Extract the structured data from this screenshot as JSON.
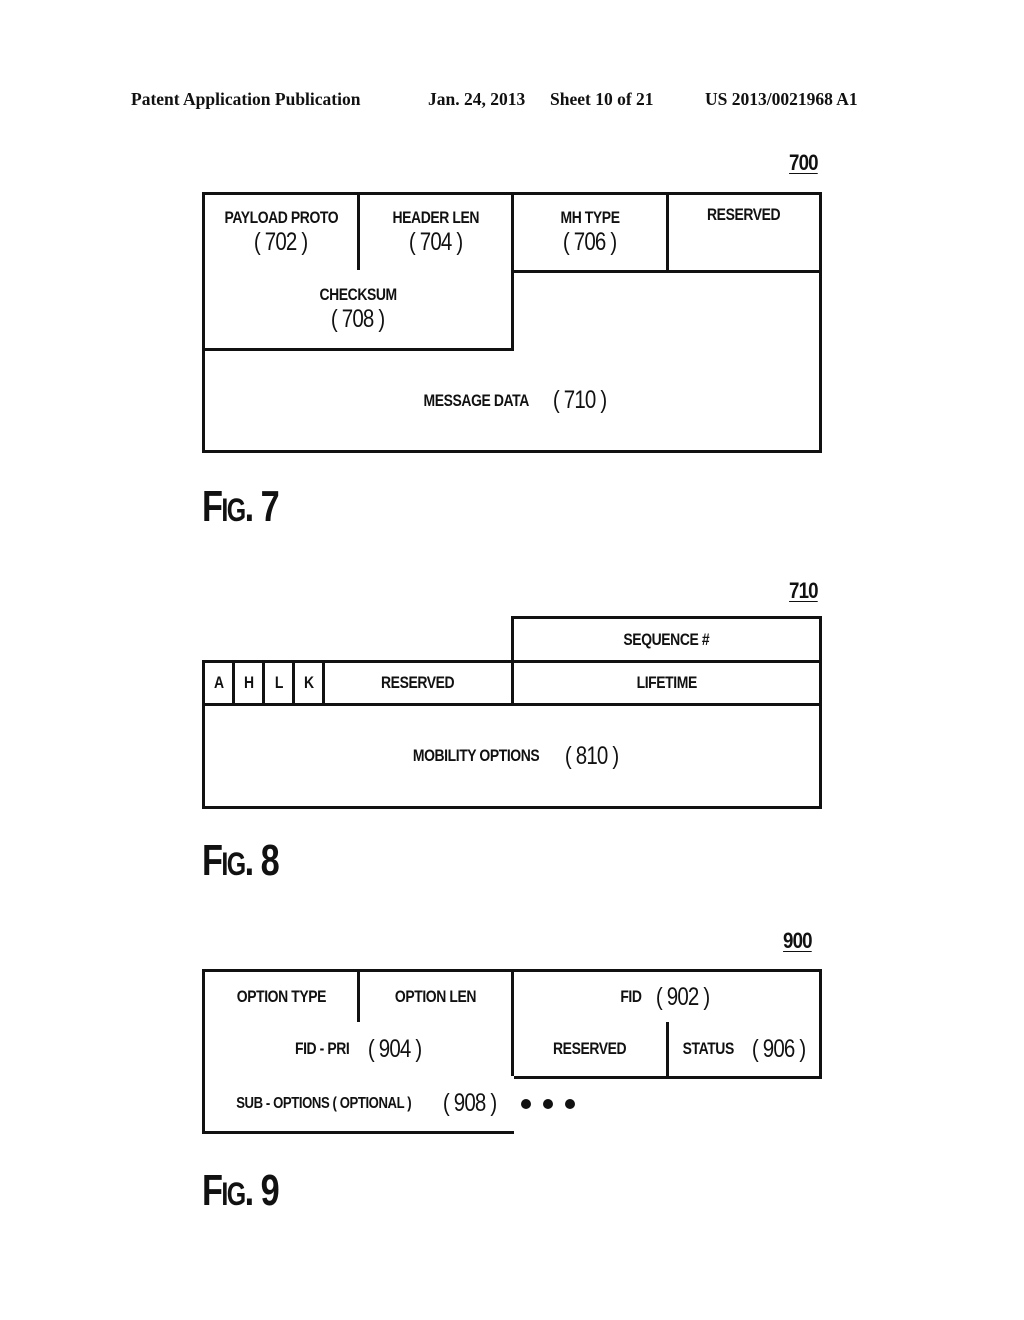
{
  "header": {
    "publication": "Patent Application Publication",
    "date": "Jan. 24, 2013",
    "sheet": "Sheet 10 of 21",
    "number": "US 2013/0021968 A1"
  },
  "fig7": {
    "ref": "700",
    "caption_big": "F",
    "caption_small": "IG",
    "caption_num": ". 7",
    "row1": [
      {
        "label": "PAYLOAD PROTO",
        "num": "( 702 )"
      },
      {
        "label": "HEADER LEN",
        "num": "( 704 )"
      },
      {
        "label": "MH TYPE",
        "num": "( 706 )"
      },
      {
        "label": "RESERVED",
        "num": ""
      }
    ],
    "checksum": {
      "label": "CHECKSUM",
      "num": "( 708 )"
    },
    "message_data": {
      "label": "MESSAGE DATA",
      "num": "( 710 )"
    }
  },
  "fig8": {
    "ref": "710",
    "caption_big": "F",
    "caption_small": "IG",
    "caption_num": ". 8",
    "sequence": "SEQUENCE #",
    "flags": [
      "A",
      "H",
      "L",
      "K"
    ],
    "reserved": "RESERVED",
    "lifetime": "LIFETIME",
    "mobility_options": {
      "label": "MOBILITY OPTIONS",
      "num": "( 810 )"
    }
  },
  "fig9": {
    "ref": "900",
    "caption_big": "F",
    "caption_small": "IG",
    "caption_num": ". 9",
    "option_type": "OPTION TYPE",
    "option_len": "OPTION LEN",
    "fid": {
      "label": "FID",
      "num": "( 902 )"
    },
    "fid_pri": {
      "label": "FID - PRI",
      "num": "( 904 )"
    },
    "reserved": "RESERVED",
    "status": {
      "label": "STATUS",
      "num": "( 906 )"
    },
    "sub_options": {
      "label": "SUB - OPTIONS ( OPTIONAL )",
      "num": "( 908 )"
    },
    "continuation_icon": "ellipsis-dots"
  }
}
